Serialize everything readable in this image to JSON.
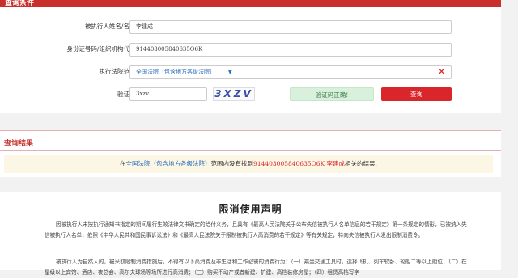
{
  "panel": {
    "title": "查询条件",
    "name_label": "被执行人姓名/名称:",
    "name_value": "李建成",
    "id_label": "身份证号码/组织机构代码:",
    "id_value": "914403005840635O6K",
    "court_label": "执行法院范围:",
    "court_value": "全国法院（包含地方各级法院）",
    "captcha_label": "验证码:",
    "captcha_input": "3xzv",
    "captcha_image_text": "3XZV",
    "verify_ok_label": "验证码正确!",
    "search_label": "查询"
  },
  "results": {
    "title": "查询结果",
    "msg_prefix": "在",
    "msg_court": "全国法院（包含地方各级法院）",
    "msg_mid": "范围内没有找到",
    "msg_id": "914403005840635O6K",
    "msg_name": "李建成",
    "msg_suffix": "相关的结果."
  },
  "declaration": {
    "title": "限消使用声明",
    "para1": "因被执行人未按执行通知书指定的期间履行生效法律文书确定的给付义务，且具有《最高人民法院关于公布失信被执行人名单信息的若干规定》第一条规定的情形，已被纳入失信被执行人名单，依照《中华人民共和国民事诉讼法》和《最高人民法院关于限制被执行人高消费的若干规定》等有关规定，特向失信被执行人发出限制消费令。",
    "para2": "被执行人为自然人的，被采取限制消费措施后，不得有以下高消费及非生活和工作必需的消费行为：（一）乘坐交通工具时，选择飞机、列车软卧、轮船二等以上舱位；（二）在星级以上宾馆、酒店、夜总会、高尔夫球场等场所进行高消费；（三）购买不动产或者新建、扩建、高档装修房屋；（四）租赁高档写字"
  },
  "colors": {
    "accent_red": "#d9262b",
    "link_blue": "#2a6ebb",
    "ok_green": "#d9f0dc",
    "notice_bg": "#fcf6e4"
  }
}
